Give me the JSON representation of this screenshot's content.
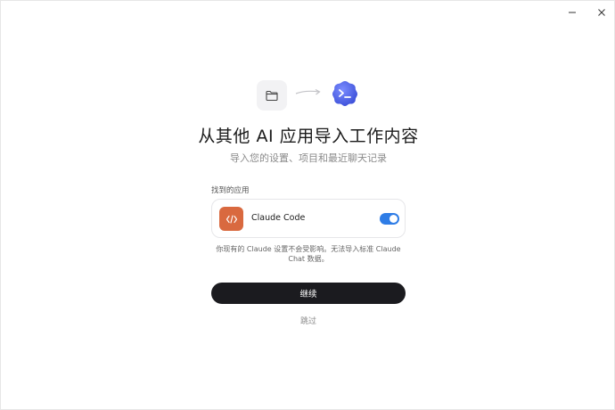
{
  "window_controls": {
    "minimize_icon": "minimize-icon",
    "close_icon": "close-icon"
  },
  "header": {
    "source_icon": "folder-icon",
    "arrow_icon": "arrow-right-icon",
    "target_icon": "terminal-blob-icon",
    "title": "从其他 AI 应用导入工作内容",
    "subtitle": "导入您的设置、项目和最近聊天记录"
  },
  "found_apps": {
    "label": "找到的应用",
    "items": [
      {
        "name": "Claude Code",
        "icon": "code-brackets-icon",
        "icon_color": "#d9693f",
        "enabled": true
      }
    ]
  },
  "note": "你现有的 Claude 设置不会受影响。无法导入标准 Claude Chat 数据。",
  "actions": {
    "continue_label": "继续",
    "skip_label": "跳过"
  },
  "colors": {
    "toggle_on": "#2f7de6",
    "primary_button": "#1b1b1f",
    "target_icon": "#4a6cf0"
  }
}
